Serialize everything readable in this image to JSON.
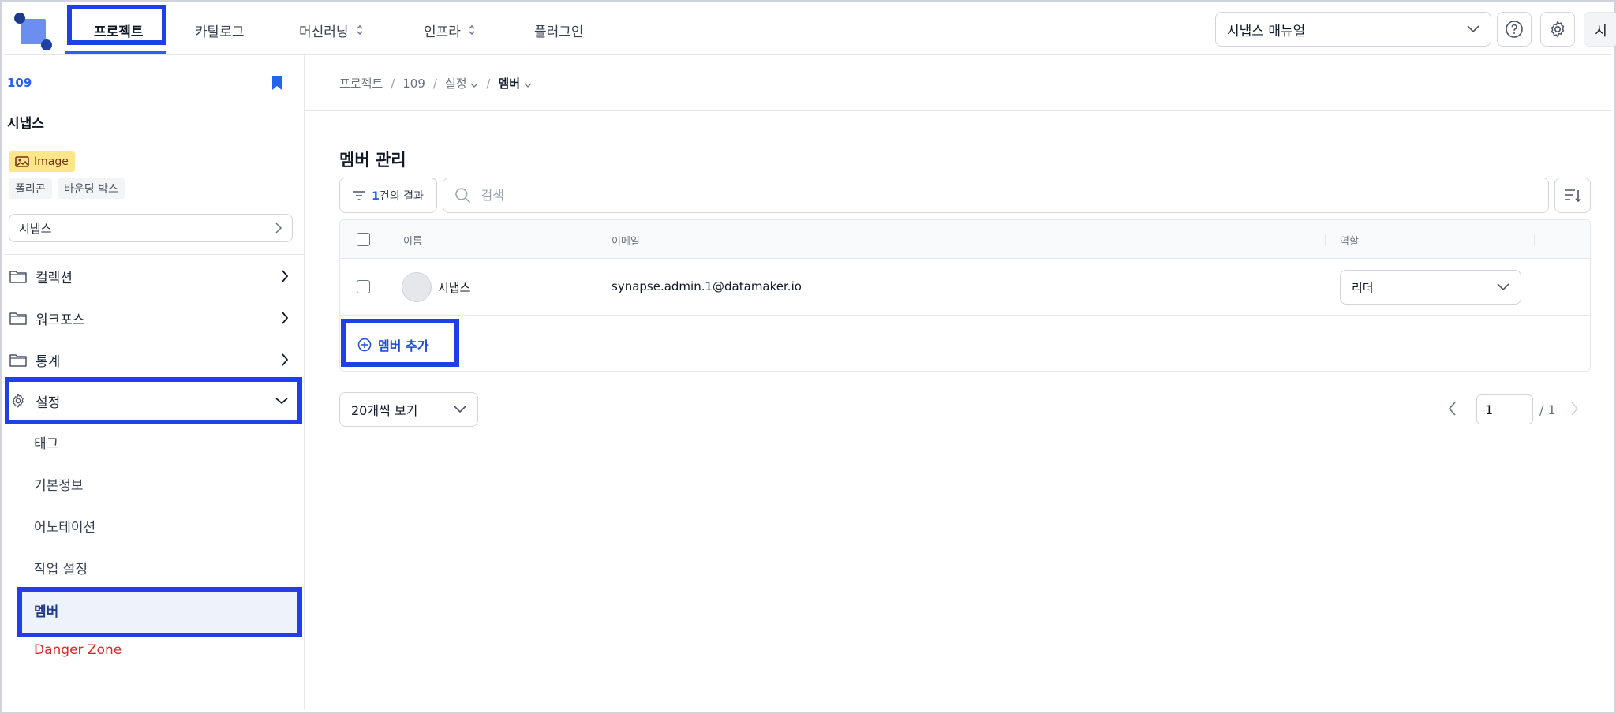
{
  "nav": {
    "items": [
      {
        "label": "프로젝트",
        "active": true
      },
      {
        "label": "카탈로그"
      },
      {
        "label": "머신러닝"
      },
      {
        "label": "인프라"
      },
      {
        "label": "플러그인"
      }
    ],
    "manual_select": "시냅스 매뉴얼",
    "user_initial": "시"
  },
  "sidebar": {
    "project_id": "109",
    "project_name": "시냅스",
    "type_badge": "Image",
    "tags": [
      "폴리곤",
      "바운딩 박스"
    ],
    "project_select": "시냅스",
    "menu": [
      {
        "label": "컬렉션",
        "icon": "folder-icon"
      },
      {
        "label": "워크포스",
        "icon": "folder-icon"
      },
      {
        "label": "통계",
        "icon": "folder-icon"
      },
      {
        "label": "설정",
        "icon": "gear-icon",
        "expanded": true
      }
    ],
    "submenu": [
      "태그",
      "기본정보",
      "어노테이션",
      "작업 설정",
      "멤버",
      "Danger Zone"
    ]
  },
  "breadcrumb": [
    "프로젝트",
    "109",
    "설정",
    "멤버"
  ],
  "main": {
    "title": "멤버 관리",
    "filter_count": "1",
    "filter_suffix": "건의 결과",
    "search_placeholder": "검색",
    "columns": [
      "이름",
      "이메일",
      "역할"
    ],
    "rows": [
      {
        "name": "시냅스",
        "email": "synapse.admin.1@datamaker.io",
        "role": "리더"
      }
    ],
    "add_member_label": "멤버 추가",
    "page_size_label": "20개씩 보기",
    "current_page": "1",
    "total_pages": "/ 1"
  },
  "colors": {
    "accent": "#2563eb",
    "highlight": "#1e40e6",
    "danger": "#dc2626",
    "badge": "#fde68a"
  }
}
